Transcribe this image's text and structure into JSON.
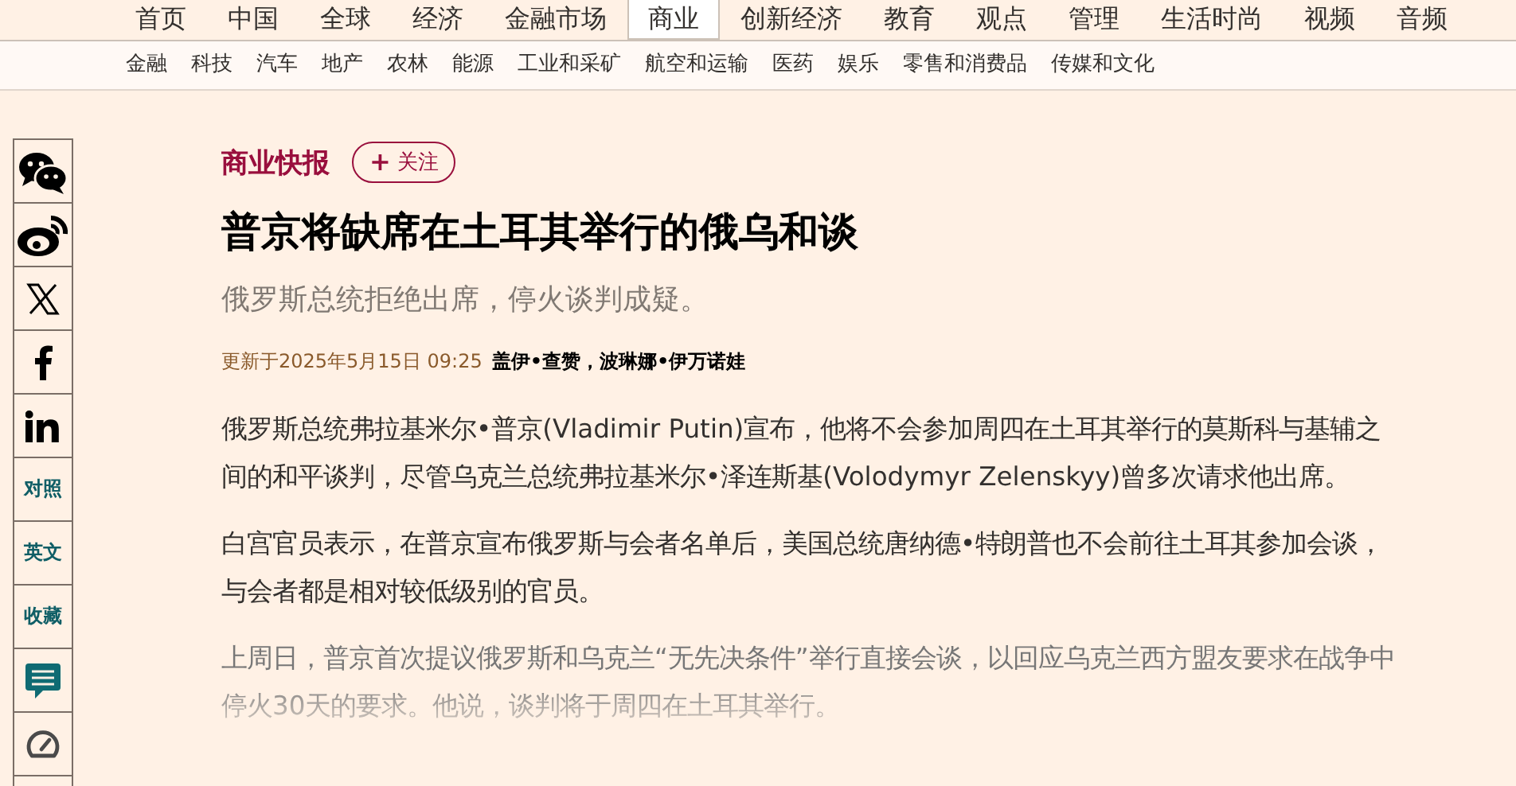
{
  "nav": {
    "items": [
      {
        "label": "首页",
        "selected": false
      },
      {
        "label": "中国",
        "selected": false
      },
      {
        "label": "全球",
        "selected": false
      },
      {
        "label": "经济",
        "selected": false
      },
      {
        "label": "金融市场",
        "selected": false
      },
      {
        "label": "商业",
        "selected": true
      },
      {
        "label": "创新经济",
        "selected": false
      },
      {
        "label": "教育",
        "selected": false
      },
      {
        "label": "观点",
        "selected": false
      },
      {
        "label": "管理",
        "selected": false
      },
      {
        "label": "生活时尚",
        "selected": false
      },
      {
        "label": "视频",
        "selected": false
      },
      {
        "label": "音频",
        "selected": false
      }
    ]
  },
  "subnav": {
    "items": [
      "金融",
      "科技",
      "汽车",
      "地产",
      "农林",
      "能源",
      "工业和采矿",
      "航空和运输",
      "医药",
      "娱乐",
      "零售和消费品",
      "传媒和文化"
    ]
  },
  "share_bar": {
    "items": [
      {
        "kind": "wechat"
      },
      {
        "kind": "weibo"
      },
      {
        "kind": "x"
      },
      {
        "kind": "facebook"
      },
      {
        "kind": "linkedin"
      },
      {
        "kind": "text",
        "label": "对照"
      },
      {
        "kind": "text",
        "label": "英文"
      },
      {
        "kind": "text",
        "label": "收藏"
      },
      {
        "kind": "comment"
      },
      {
        "kind": "gauge"
      }
    ]
  },
  "article": {
    "category": "商业快报",
    "follow_button": {
      "icon": "+",
      "label": "关注"
    },
    "title": "普京将缺席在土耳其举行的俄乌和谈",
    "subtitle": "俄罗斯总统拒绝出席，停火谈判成疑。",
    "updated": "更新于2025年5月15日 09:25",
    "authors": "盖伊•查赞，波琳娜•伊万诺娃",
    "paragraphs": [
      {
        "text": "俄罗斯总统弗拉基米尔•普京(Vladimir Putin)宣布，他将不会参加周四在土耳其举行的莫斯科与基辅之间的和平谈判，尽管乌克兰总统弗拉基米尔•泽连斯基(Volodymyr Zelenskyy)曾多次请求他出席。",
        "faded": false
      },
      {
        "text": "白宫官员表示，在普京宣布俄罗斯与会者名单后，美国总统唐纳德•特朗普也不会前往土耳其参加会谈，与会者都是相对较低级别的官员。",
        "faded": false
      },
      {
        "text": "上周日，普京首次提议俄罗斯和乌克兰“无先决条件”举行直接会谈，以回应乌克兰西方盟友要求在战争中停火30天的要求。他说，谈判将于周四在土耳其举行。",
        "faded": true
      }
    ]
  }
}
